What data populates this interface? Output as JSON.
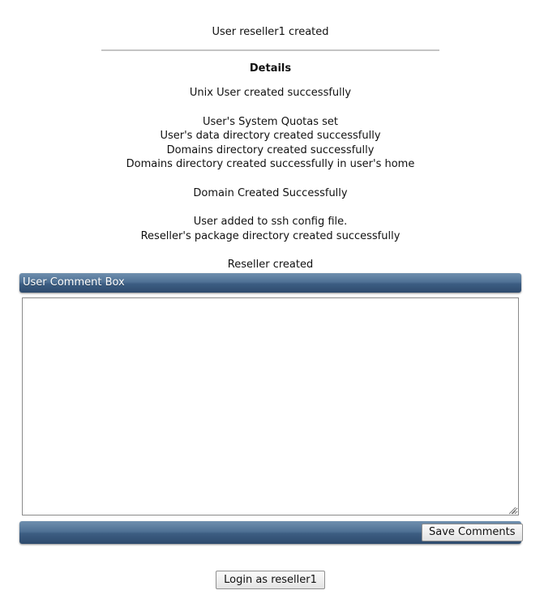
{
  "header": {
    "title": "User reseller1 created"
  },
  "details": {
    "heading": "Details",
    "messages": [
      "Unix User created successfully",
      "",
      "User's System Quotas set",
      "User's data directory created successfully",
      "Domains directory created successfully",
      "Domains directory created successfully in user's home",
      "",
      "Domain Created Successfully",
      "",
      "User added to ssh config file.",
      "Reseller's package directory created successfully",
      "",
      "Reseller created"
    ]
  },
  "comment_box": {
    "title": "User Comment Box",
    "value": "",
    "save_label": "Save Comments"
  },
  "login": {
    "label": "Login as reseller1"
  },
  "colors": {
    "bar_top": "#6f8fae",
    "bar_bottom": "#2e4b6d",
    "divider": "#c4c4c4"
  }
}
